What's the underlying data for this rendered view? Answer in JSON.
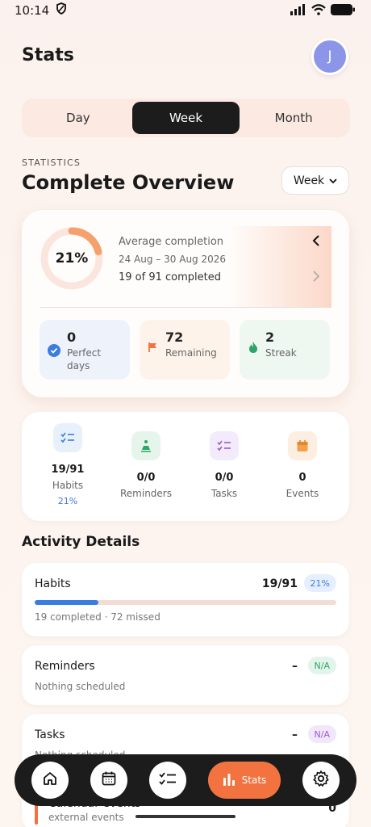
{
  "status_bar": {
    "time": "10:14"
  },
  "header": {
    "title": "Stats",
    "avatar_initial": "J"
  },
  "segments": [
    "Day",
    "Week",
    "Month"
  ],
  "section": {
    "eyebrow": "STATISTICS",
    "title": "Complete Overview",
    "period": "Week"
  },
  "overview": {
    "percent": "21%",
    "percent_value": 0.21,
    "avg_label": "Average completion",
    "range": "24 Aug – 30 Aug 2026",
    "completed": "19 of 91 completed",
    "stats": [
      {
        "num": "0",
        "label": "Perfect days"
      },
      {
        "num": "72",
        "label": "Remaining"
      },
      {
        "num": "2",
        "label": "Streak"
      }
    ]
  },
  "counts": [
    {
      "num": "19/91",
      "label": "Habits",
      "pct": "21%"
    },
    {
      "num": "0/0",
      "label": "Reminders"
    },
    {
      "num": "0/0",
      "label": "Tasks"
    },
    {
      "num": "0",
      "label": "Events"
    }
  ],
  "activity": {
    "title": "Activity Details",
    "items": [
      {
        "name": "Habits",
        "count": "19/91",
        "pill": "21%",
        "sub": "19 completed · 72 missed",
        "progress": 0.21
      },
      {
        "name": "Reminders",
        "count": "–",
        "pill": "N/A",
        "sub": "Nothing scheduled"
      },
      {
        "name": "Tasks",
        "count": "–",
        "pill": "N/A",
        "sub": "Nothing scheduled"
      },
      {
        "name": "Calendar events",
        "count": "0",
        "sub": "external events"
      }
    ]
  },
  "tabbar": {
    "active_label": "Stats"
  },
  "colors": {
    "accent": "#f2733f",
    "habit_blue": "#3b7ce0",
    "dark": "#1c1c1c"
  }
}
